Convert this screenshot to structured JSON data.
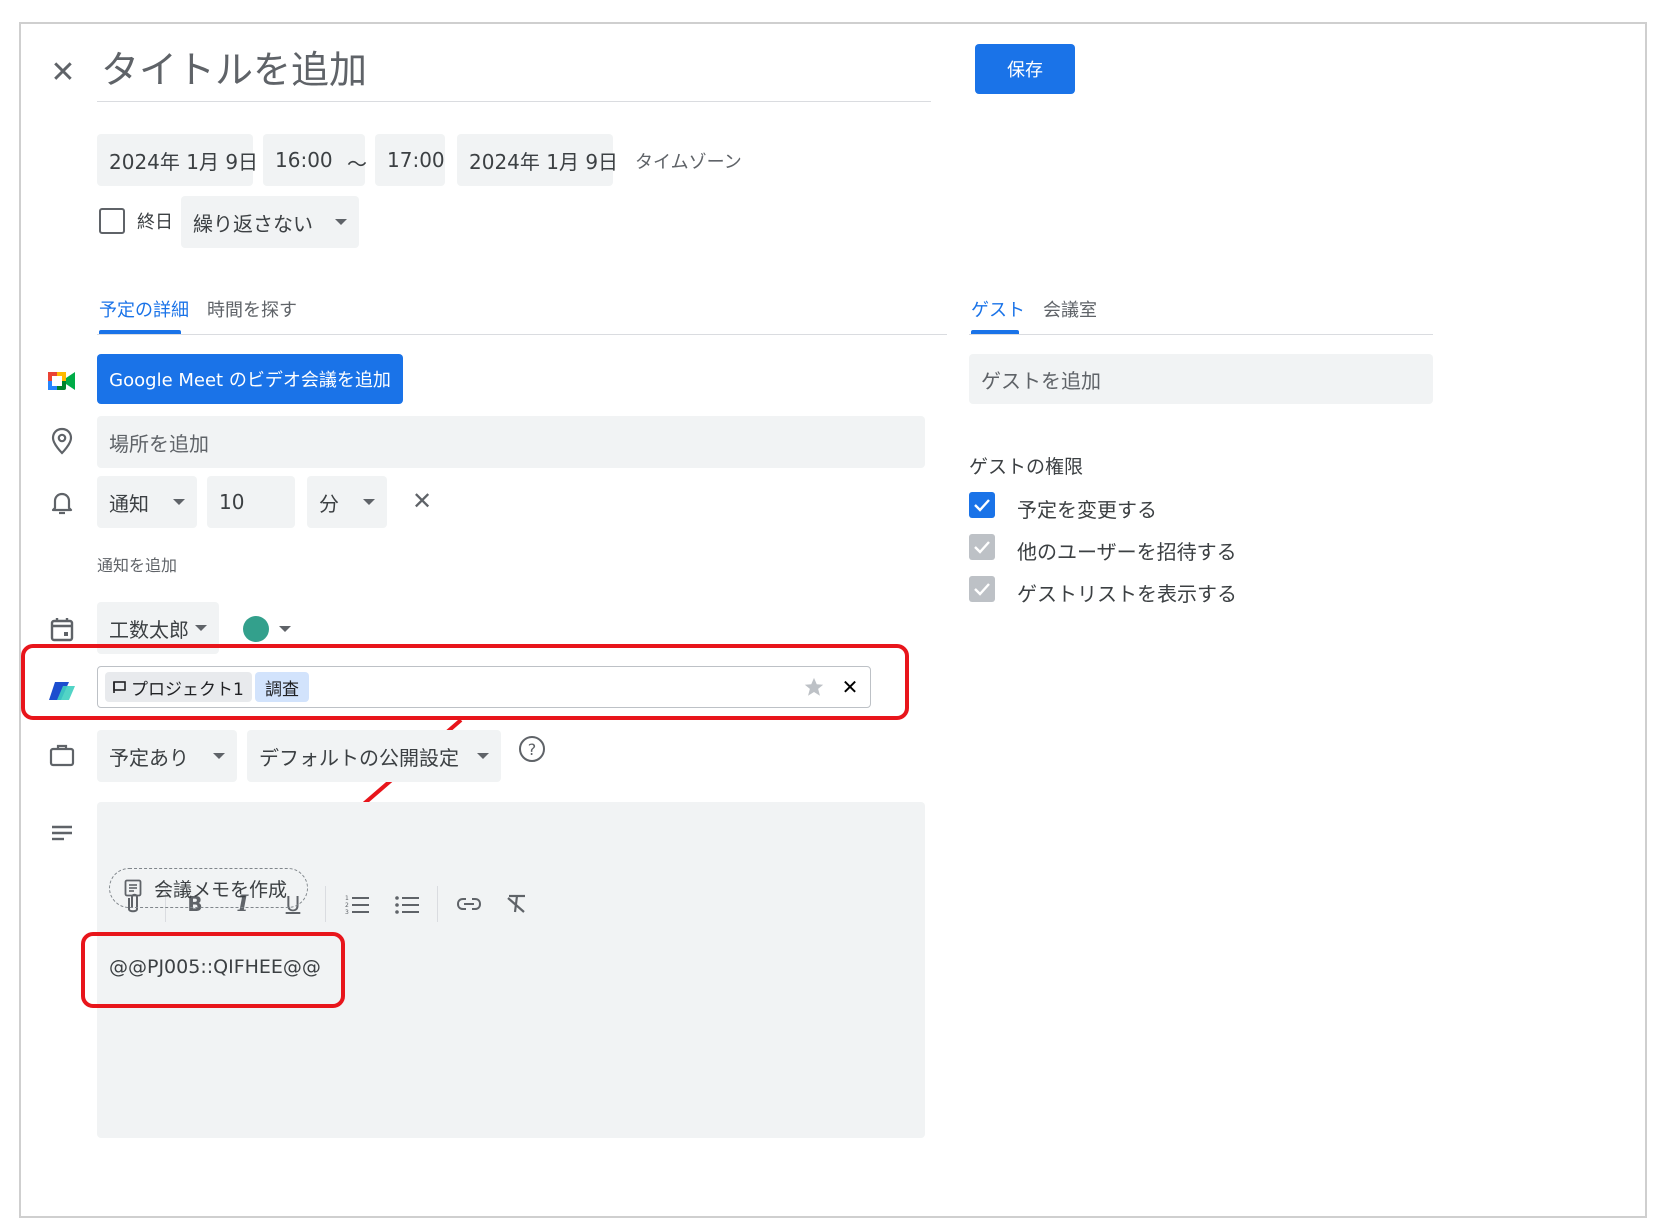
{
  "header": {
    "title_placeholder": "タイトルを追加",
    "save_label": "保存"
  },
  "datetime": {
    "start_date": "2024年 1月 9日",
    "start_time": "16:00",
    "separator": "～",
    "end_time": "17:00",
    "end_date": "2024年 1月 9日",
    "timezone_label": "タイムゾーン",
    "all_day_label": "終日",
    "repeat_value": "繰り返さない"
  },
  "tabs": {
    "details": "予定の詳細",
    "find_time": "時間を探す",
    "guests": "ゲスト",
    "rooms": "会議室"
  },
  "meet": {
    "button_label": "Google Meet のビデオ会議を追加"
  },
  "location": {
    "placeholder": "場所を追加"
  },
  "notification": {
    "type": "通知",
    "amount": "10",
    "unit": "分",
    "add_label": "通知を追加"
  },
  "calendar": {
    "owner": "工数太郎",
    "color": "#33a08c"
  },
  "project": {
    "project_tag": "プロジェクト1",
    "task_tag": "調査"
  },
  "availability": {
    "status": "予定あり",
    "visibility": "デフォルトの公開設定"
  },
  "description": {
    "meeting_notes_label": "会議メモを作成",
    "body_text": "@@PJ005::QIFHEE@@"
  },
  "guests": {
    "add_placeholder": "ゲストを追加",
    "permissions_title": "ゲストの権限",
    "permissions": [
      {
        "label": "予定を変更する",
        "checked": true,
        "enabled": true
      },
      {
        "label": "他のユーザーを招待する",
        "checked": true,
        "enabled": false
      },
      {
        "label": "ゲストリストを表示する",
        "checked": true,
        "enabled": false
      }
    ]
  },
  "colors": {
    "accent": "#1a73e8",
    "highlight": "#e8151b",
    "field_bg": "#f1f3f4"
  }
}
